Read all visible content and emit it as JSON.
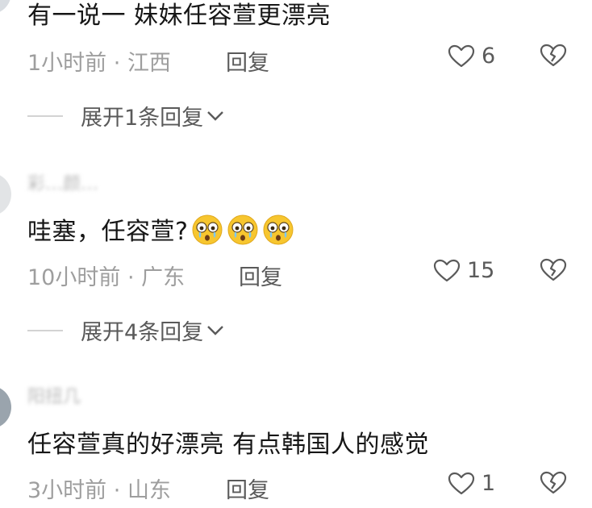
{
  "comments": [
    {
      "username": "",
      "text": "有一说一  妹妹任容萱更漂亮",
      "time": "1小时前",
      "location": "江西",
      "reply_label": "回复",
      "likes": "6",
      "expand_label": "展开1条回复"
    },
    {
      "username": "彩…颜…",
      "text": "哇塞，任容萱?",
      "emoji_count": 3,
      "time": "10小时前",
      "location": "广东",
      "reply_label": "回复",
      "likes": "15",
      "expand_label": "展开4条回复"
    },
    {
      "username": "阳扭几",
      "text": "任容萱真的好漂亮 有点韩国人的感觉",
      "time": "3小时前",
      "location": "山东",
      "reply_label": "回复",
      "likes": "1"
    }
  ],
  "meta_separator": " · ",
  "icons": {
    "like": "heart-outline-icon",
    "dislike": "broken-heart-icon",
    "expand": "chevron-down-icon",
    "emoji": "crying-face-emoji"
  },
  "colors": {
    "text": "#161616",
    "muted": "#9e9e9e",
    "action": "#5a5a5a",
    "emoji": "#f7c62f"
  }
}
